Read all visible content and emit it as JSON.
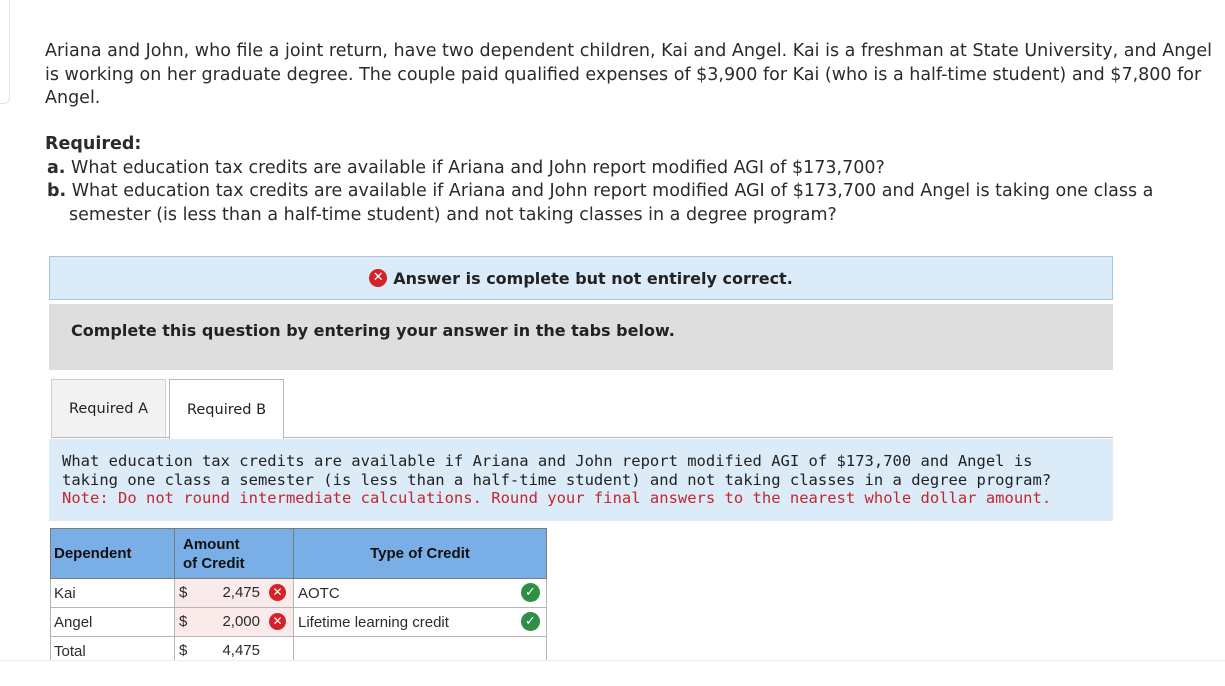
{
  "problem": {
    "intro": "Ariana and John, who file a joint return, have two dependent children, Kai and Angel. Kai is a freshman at State University, and Angel is working on her graduate degree. The couple paid qualified expenses of $3,900 for Kai (who is a half-time student) and $7,800 for Angel.",
    "required_heading": "Required:",
    "req_a_label": "a.",
    "req_a_text": " What education tax credits are available if Ariana and John report modified AGI of $173,700?",
    "req_b_label": "b.",
    "req_b_text": " What education tax credits are available if Ariana and John report modified AGI of $173,700 and Angel is taking one class a semester (is less than a half-time student) and not taking classes in a degree program?"
  },
  "status": {
    "icon": "x-circle-icon",
    "text": "Answer is complete but not entirely correct.",
    "color": "#d3222a"
  },
  "instructions": "Complete this question by entering your answer in the tabs below.",
  "tabs": [
    {
      "label": "Required A",
      "active": false
    },
    {
      "label": "Required B",
      "active": true
    }
  ],
  "question": {
    "text": "What education tax credits are available if Ariana and John report modified AGI of $173,700 and Angel is taking one class a semester (is less than a half-time student) and not taking classes in a degree program?",
    "note": "Note: Do not round intermediate calculations. Round your final answers to the nearest whole dollar amount."
  },
  "table": {
    "headers": {
      "dependent": "Dependent",
      "amount_line1": "Amount",
      "amount_line2": "of Credit",
      "type": "Type of Credit"
    },
    "rows": [
      {
        "dependent": "Kai",
        "currency": "$",
        "amount": "2,475",
        "amount_correct": false,
        "type": "AOTC",
        "type_correct": true
      },
      {
        "dependent": "Angel",
        "currency": "$",
        "amount": "2,000",
        "amount_correct": false,
        "type": "Lifetime learning credit",
        "type_correct": true
      },
      {
        "dependent": "Total",
        "currency": "$",
        "amount": "4,475"
      }
    ],
    "header_color": "#7aaee6",
    "correct_color": "#2f8f46",
    "wrong_color": "#d3222a"
  }
}
